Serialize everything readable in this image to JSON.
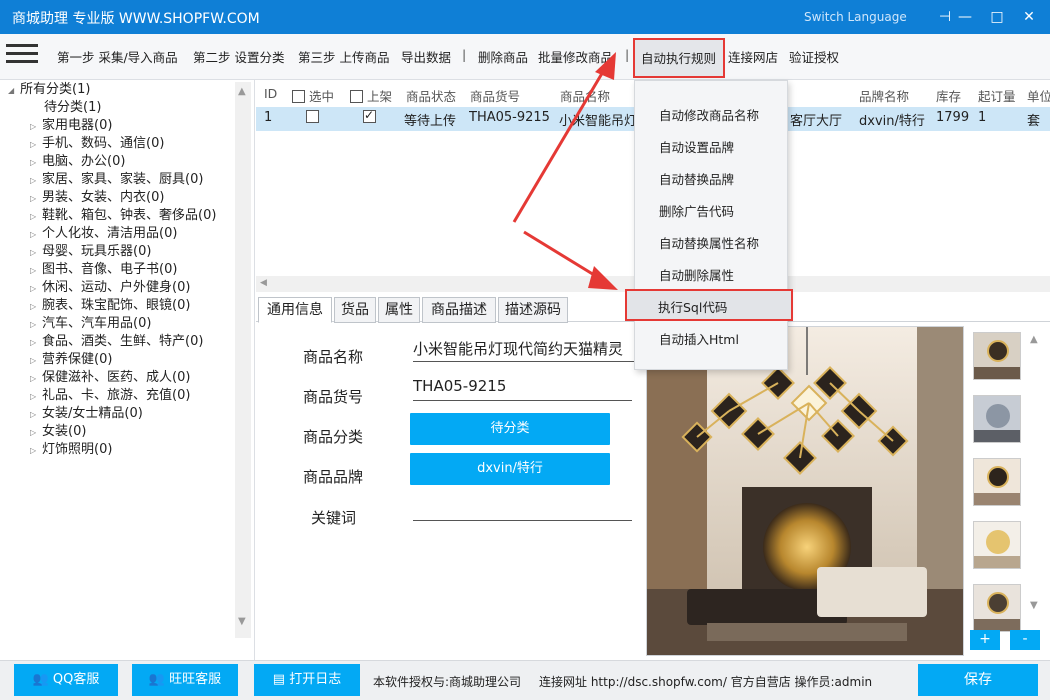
{
  "window": {
    "title": "商城助理 专业版 WWW.SHOPFW.COM",
    "switch_language": "Switch Language",
    "pin": "⊣",
    "minimize": "—",
    "maximize": "□",
    "close": "✕"
  },
  "toolbar": {
    "items": [
      "第一步 采集/导入商品",
      "第二步 设置分类",
      "第三步 上传商品",
      "导出数据",
      "删除商品",
      "批量修改商品"
    ],
    "sep": "|",
    "active": "自动执行规则",
    "after": [
      "连接网店",
      "验证授权"
    ]
  },
  "tree": {
    "root": "所有分类(1)",
    "pending": "待分类(1)",
    "items": [
      "家用电器(0)",
      "手机、数码、通信(0)",
      "电脑、办公(0)",
      "家居、家具、家装、厨具(0)",
      "男装、女装、内衣(0)",
      "鞋靴、箱包、钟表、奢侈品(0)",
      "个人化妆、清洁用品(0)",
      "母婴、玩具乐器(0)",
      "图书、音像、电子书(0)",
      "休闲、运动、户外健身(0)",
      "腕表、珠宝配饰、眼镜(0)",
      "汽车、汽车用品(0)",
      "食品、酒类、生鲜、特产(0)",
      "营养保健(0)",
      "保健滋补、医药、成人(0)",
      "礼品、卡、旅游、充值(0)",
      "女装/女士精品(0)",
      "女装(0)",
      "灯饰照明(0)"
    ]
  },
  "grid": {
    "headers": {
      "id": "ID",
      "selected": "选中",
      "listed": "上架",
      "status": "商品状态",
      "sku": "商品货号",
      "name": "商品名称",
      "brand": "品牌名称",
      "stock": "库存",
      "moq": "起订量",
      "unit": "单位"
    },
    "row": {
      "id": "1",
      "status": "等待上传",
      "sku": "THA05-9215",
      "name": "小米智能吊灯现代简约天猫精灵",
      "name_tail": "客厅大厅",
      "brand": "dxvin/特行",
      "stock": "1799",
      "moq": "1",
      "unit": "套"
    }
  },
  "menu": {
    "items": [
      "自动修改商品名称",
      "自动设置品牌",
      "自动替换品牌",
      "删除广告代码",
      "自动替换属性名称",
      "自动删除属性",
      "执行Sql代码",
      "自动插入Html"
    ]
  },
  "tabs": [
    "通用信息",
    "货品",
    "属性",
    "商品描述",
    "描述源码"
  ],
  "form": {
    "name_label": "商品名称",
    "name_value": "小米智能吊灯现代简约天猫精灵",
    "sku_label": "商品货号",
    "sku_value": "THA05-9215",
    "category_label": "商品分类",
    "category_value": "待分类",
    "brand_label": "商品品牌",
    "brand_value": "dxvin/特行",
    "keywords_label": "关键词",
    "keywords_value": ""
  },
  "images": {
    "plus": "+",
    "minus": "-"
  },
  "footer": {
    "qq": "QQ客服",
    "wangwang": "旺旺客服",
    "log": "打开日志",
    "license": "本软件授权与:商城助理公司",
    "connection": "连接网址 http://dsc.shopfw.com/ 官方自营店 操作员:admin",
    "save": "保存"
  },
  "colors": {
    "titlebar": "#0f7fd6",
    "accent": "#03a9f4",
    "highlight": "#e53935",
    "selected_row": "#cde6f7"
  }
}
